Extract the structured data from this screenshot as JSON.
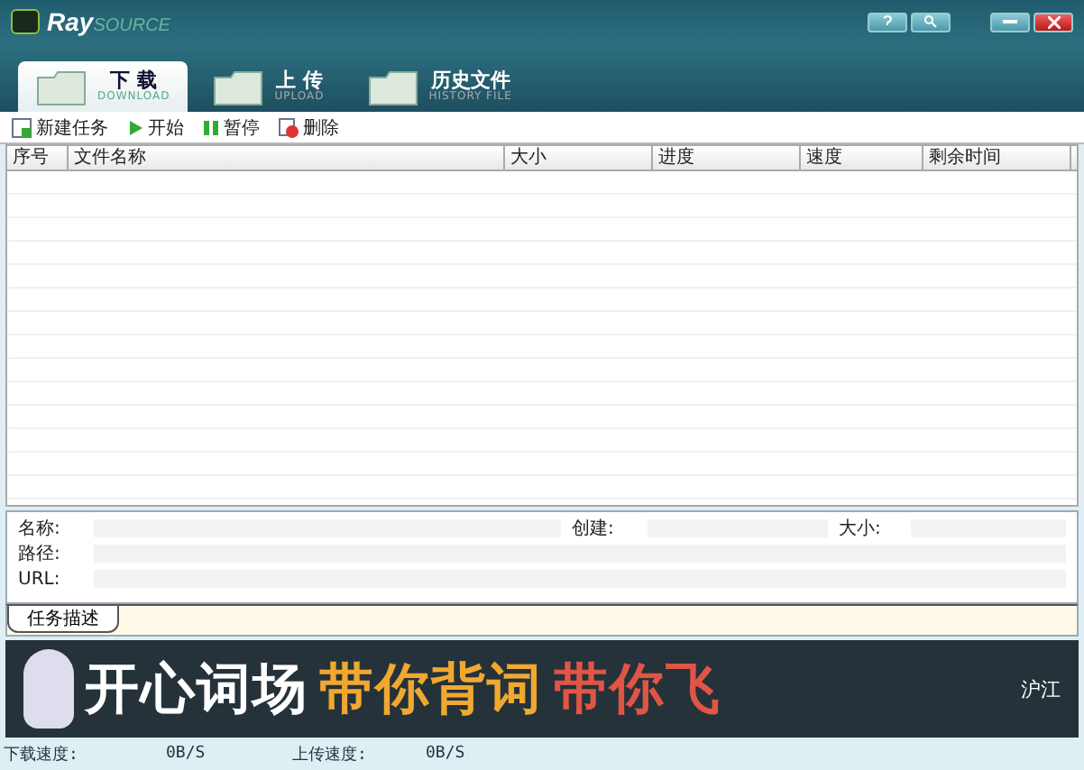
{
  "window": {
    "logo": "Ray",
    "logo_suffix": "SOURCE"
  },
  "tabs": [
    {
      "label": "下 载",
      "sublabel": "DOWNLOAD",
      "selected": true
    },
    {
      "label": "上 传",
      "sublabel": "UPLOAD",
      "selected": false
    },
    {
      "label": "历史文件",
      "sublabel": "HISTORY FILE",
      "selected": false
    }
  ],
  "toolbar": [
    {
      "kind": "new",
      "label": "新建任务"
    },
    {
      "kind": "start",
      "label": "开始"
    },
    {
      "kind": "pause",
      "label": "暂停"
    },
    {
      "kind": "delete",
      "label": "删除"
    }
  ],
  "table": {
    "columns": [
      "序号",
      "文件名称",
      "大小",
      "进度",
      "速度",
      "剩余时间"
    ]
  },
  "details": {
    "name_label": "名称:",
    "created_label": "创建:",
    "size_label": "大小:",
    "path_label": "路径:",
    "url_label": "URL:",
    "tab": "任务描述"
  },
  "banner": {
    "parts": [
      {
        "text": "开心词场",
        "color": "#ffffff"
      },
      {
        "text": "带你背词",
        "color": "#f0a830"
      },
      {
        "text": "带你飞",
        "color": "#e05545"
      }
    ],
    "brand": "沪江"
  },
  "status_bar": {
    "download_label": "下载速度:",
    "download_value": "0B/S",
    "upload_label": "上传速度:",
    "upload_value": "0B/S"
  }
}
